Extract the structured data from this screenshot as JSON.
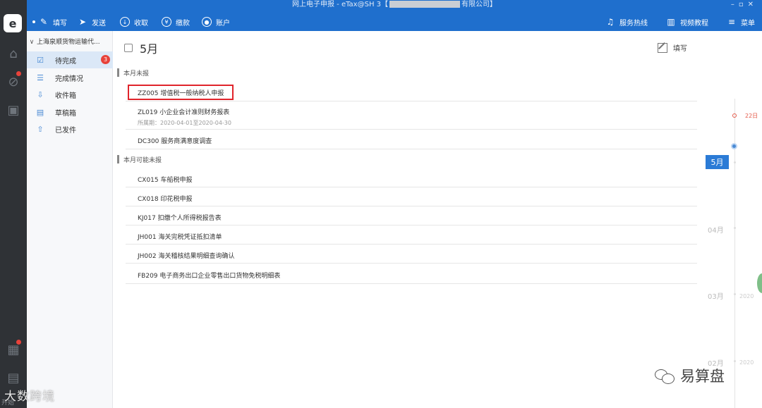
{
  "window": {
    "title_prefix": "网上电子申报 - eTax@SH 3【",
    "title_suffix": "有限公司】"
  },
  "toolbar": {
    "left": [
      {
        "label": "填写",
        "icon": "edit-icon"
      },
      {
        "label": "发送",
        "icon": "send-icon"
      },
      {
        "label": "收取",
        "icon": "download-icon"
      },
      {
        "label": "缴款",
        "icon": "yen-icon"
      },
      {
        "label": "账户",
        "icon": "user-icon"
      }
    ],
    "right": [
      {
        "label": "服务热线",
        "icon": "headset-icon"
      },
      {
        "label": "视频教程",
        "icon": "video-icon"
      },
      {
        "label": "菜单",
        "icon": "menu-icon"
      }
    ]
  },
  "sidebar": {
    "org_name": "上海泉顺货物运输代...",
    "items": [
      {
        "label": "待完成",
        "badge": "3",
        "active": true,
        "icon": "checklist-icon"
      },
      {
        "label": "完成情况",
        "icon": "list-icon"
      },
      {
        "label": "收件箱",
        "icon": "inbox-icon"
      },
      {
        "label": "草稿箱",
        "icon": "draft-icon"
      },
      {
        "label": "已发件",
        "icon": "sent-icon"
      }
    ]
  },
  "main": {
    "month_title": "5月",
    "fill_label": "填写",
    "section_unreported": "本月未报",
    "section_possible": "本月可能未报",
    "unreported": [
      {
        "code": "ZZ005 增值税一般纳税人申报"
      },
      {
        "code": "ZL019 小企业会计准则财务报表",
        "sub": "所属期：2020-04-01至2020-04-30"
      },
      {
        "code": "DC300 服务商满意度调查"
      }
    ],
    "possible": [
      {
        "code": "CX015 车船税申报"
      },
      {
        "code": "CX018 印花税申报"
      },
      {
        "code": "KJ017 扣缴个人所得税报告表"
      },
      {
        "code": "JH001 海关完税凭证抵扣清单"
      },
      {
        "code": "JH002 海关稽核结果明细查询确认"
      },
      {
        "code": "FB209 电子商务出口企业零售出口货物免税明细表"
      }
    ]
  },
  "timeline": {
    "today": "22日",
    "current": "5月",
    "months": [
      "04月",
      "03月",
      "02月"
    ],
    "years": [
      "2020",
      "2020"
    ]
  },
  "watermark": {
    "left": "大数跨境",
    "right": "易算盘",
    "corner": "开始"
  },
  "colors": {
    "topbar": "#1f6fcd",
    "rail": "#2f3236",
    "accent": "#2b7bd6",
    "highlight": "#e0242b"
  }
}
